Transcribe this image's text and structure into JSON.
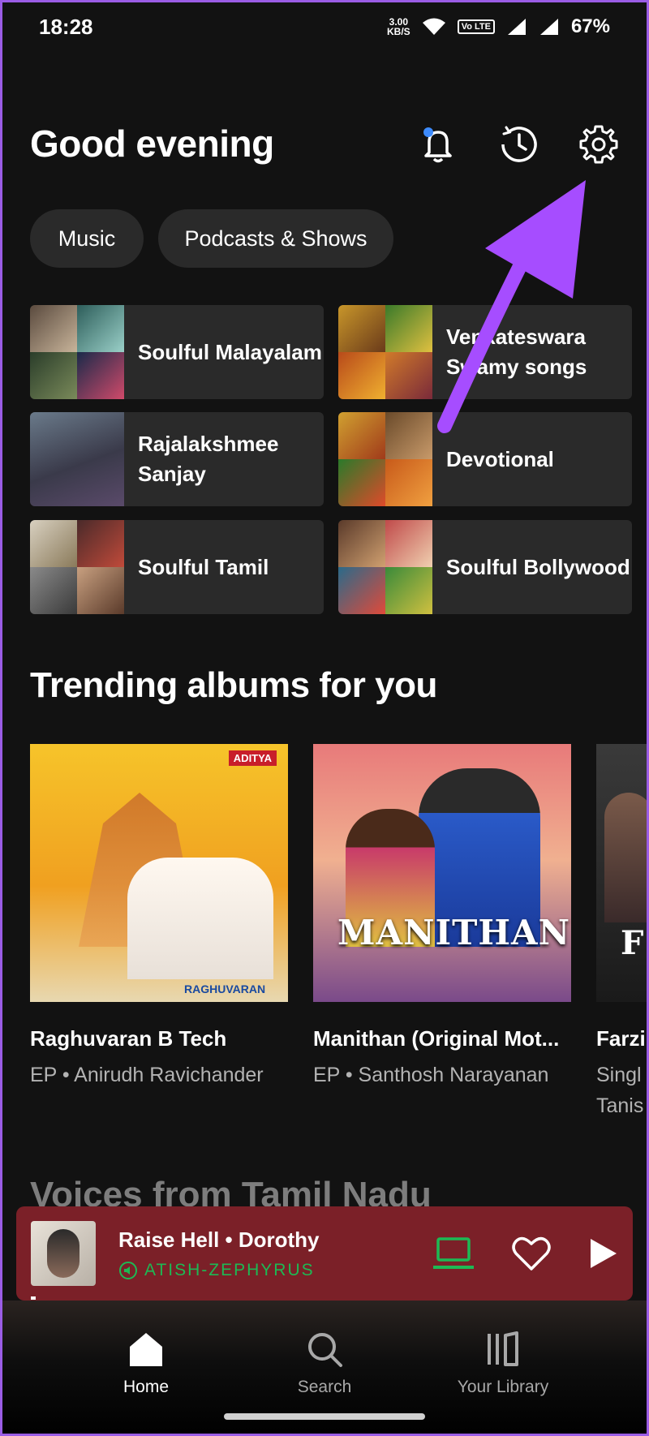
{
  "status_bar": {
    "time": "18:28",
    "net_speed_value": "3.00",
    "net_speed_unit": "KB/S",
    "volte": "Vo LTE",
    "battery": "67%"
  },
  "header": {
    "greeting": "Good evening",
    "icons": [
      "bell-icon",
      "history-icon",
      "settings-icon"
    ]
  },
  "filters": [
    "Music",
    "Podcasts & Shows"
  ],
  "shortcuts": [
    {
      "label": "Soulful Malayalam"
    },
    {
      "label": "Venkateswara Swamy songs"
    },
    {
      "label": "Rajalakshmee Sanjay"
    },
    {
      "label": "Devotional"
    },
    {
      "label": "Soulful Tamil"
    },
    {
      "label": "Soulful Bollywood"
    }
  ],
  "trending": {
    "title": "Trending albums for you",
    "albums": [
      {
        "title": "Raghuvaran B Tech",
        "subtitle": "EP • Anirudh Ravichander",
        "cover_text": "RAGHUVARAN",
        "cover_tag": "ADITYA"
      },
      {
        "title": "Manithan (Original Mot...",
        "subtitle": "EP • Santhosh Narayanan",
        "cover_text": "MANITHAN"
      },
      {
        "title": "Farzi",
        "subtitle": "Singl Tanis",
        "cover_text": "F"
      }
    ]
  },
  "next_section": {
    "title": "Voices from Tamil Nadu"
  },
  "now_playing": {
    "track": "Raise Hell • Dorothy",
    "device": "ATISH-ZEPHYRUS"
  },
  "nav": [
    {
      "label": "Home"
    },
    {
      "label": "Search"
    },
    {
      "label": "Your Library"
    }
  ],
  "colors": {
    "background": "#121212",
    "tile": "#2a2a2a",
    "player": "#7b2028",
    "accent_green": "#1db954",
    "annotation_arrow": "#a64dff"
  }
}
